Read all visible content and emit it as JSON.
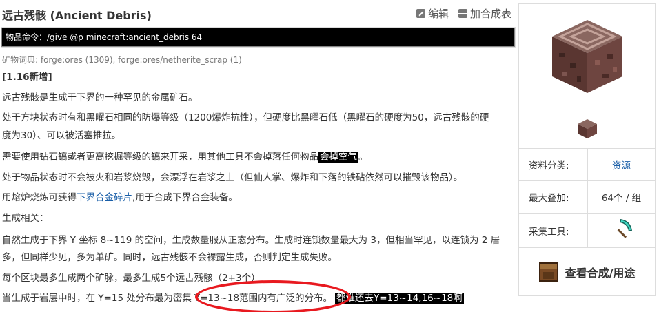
{
  "title": "远古残骸 (Ancient Debris)",
  "actions": {
    "edit": "编辑",
    "add_compare": "加合成表"
  },
  "command": "物品命令：/give @p minecraft:ancient_debris 64",
  "dictionary": "矿物词典: forge:ores (1309), forge:ores/netherite_scrap (1)",
  "version": "[1.16新增]",
  "paragraphs": {
    "p1": "远古残骸是生成于下界的一种罕见的金属矿石。",
    "p2a": "处于方块状态时有和黑曜石相同的防爆等级（1200爆炸抗性），但硬度比黑曜石低（黑曜石的硬度为50，远古残骸的硬",
    "p2b": "度为30）、可以被活塞推拉。",
    "p3a": "需要使用钻石镐或者更高挖掘等级的镐来开采，用其他工具不会掉落任何物品",
    "p3hl": "会掉空气",
    "p3b": "。",
    "p4": "处于物品状态时不会被火和岩浆烧毁，会漂浮在岩浆之上（但仙人掌、爆炸和下落的铁砧依然可以摧毁该物品）。",
    "p5a": "用熔炉烧炼可获得",
    "p5link": "下界合金碎片",
    "p5b": ",用于合成下界合金装备。",
    "p6": "生成相关：",
    "p7a": "自然生成于下界 Y 坐标 8~119 的空间，生成数量服从正态分布。生成时连锁数量最大为 3，但相当罕见，以连锁为 2 居",
    "p7b": "多，但同样少见，多为单矿。同时，远古残骸不会裸露生成，否则判定生成失败。",
    "p8": "每个区块最多生成两个矿脉，最多生成5个远古残骸（2+3个）",
    "p9a": "当生成于岩层中时，在 Y=15 处分布最为密集",
    "p9b": "Y=13~18范围内有广泛的分布。",
    "p9hl": "都谁还去Y=13~14,16~18啊"
  },
  "infobox": {
    "category_label": "资料分类:",
    "category_value": "资源",
    "stack_label": "最大叠加:",
    "stack_value": "64个 / 组",
    "tool_label": "采集工具:",
    "tool_icon": "diamond-pickaxe-icon",
    "recipe_button": "查看合成/用途"
  },
  "colors": {
    "link": "#1a5fa8",
    "highlight_bg": "#000000",
    "circle": "#e8191f"
  }
}
